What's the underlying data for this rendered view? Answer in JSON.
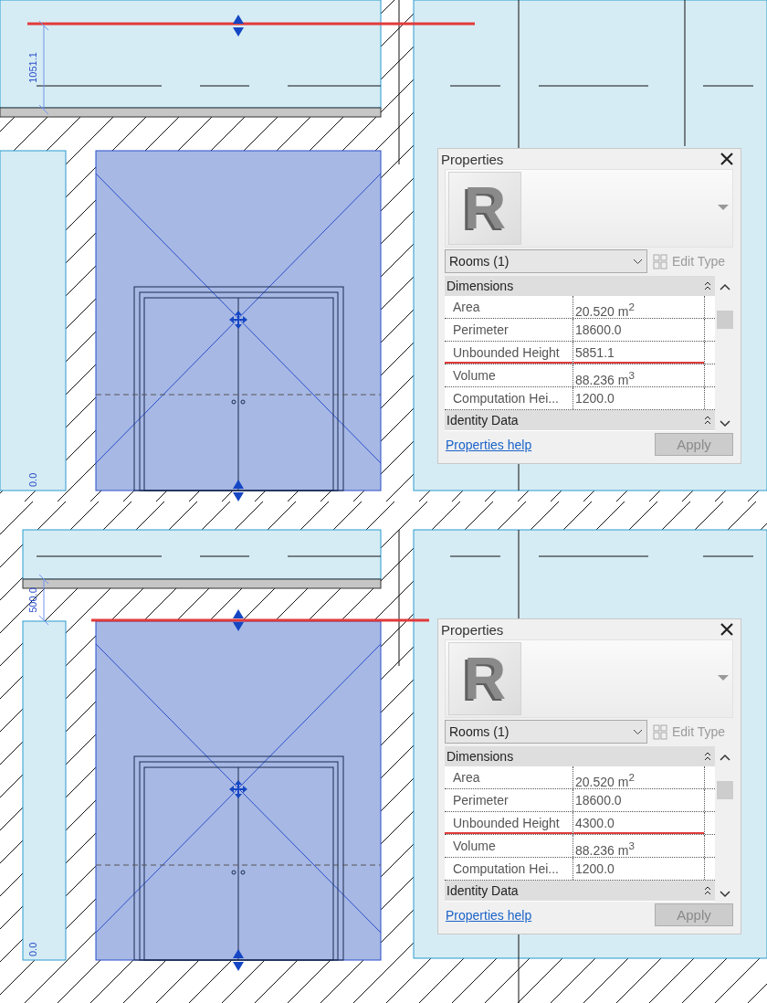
{
  "views": [
    {
      "dimension_labels": [
        "1051.1",
        "0.0"
      ],
      "properties": {
        "title": "Properties",
        "logo": "R",
        "type_selector": "Rooms (1)",
        "edit_type": {
          "label": "Edit Type",
          "disabled": true
        },
        "sections": [
          {
            "title": "Dimensions",
            "rows": [
              {
                "label": "Area",
                "value": "20.520 m$^{2}$",
                "underlined": false
              },
              {
                "label": "Perimeter",
                "value": "18600.0",
                "underlined": false
              },
              {
                "label": "Unbounded Height",
                "value": "5851.1",
                "underlined": true
              },
              {
                "label": "Volume",
                "value": "88.236 m$^{3}$",
                "underlined": false
              },
              {
                "label": "Computation Hei...",
                "value": "1200.0",
                "underlined": false
              }
            ]
          },
          {
            "title": "Identity Data"
          }
        ],
        "help_link": "Properties help",
        "apply": {
          "label": "Apply",
          "disabled": true
        }
      }
    },
    {
      "dimension_labels": [
        "500.0",
        "0.0"
      ],
      "properties": {
        "title": "Properties",
        "logo": "R",
        "type_selector": "Rooms (1)",
        "edit_type": {
          "label": "Edit Type",
          "disabled": true
        },
        "sections": [
          {
            "title": "Dimensions",
            "rows": [
              {
                "label": "Area",
                "value": "20.520 m$^{2}$",
                "underlined": false
              },
              {
                "label": "Perimeter",
                "value": "18600.0",
                "underlined": false
              },
              {
                "label": "Unbounded Height",
                "value": "4300.0",
                "underlined": true
              },
              {
                "label": "Volume",
                "value": "88.236 m$^{3}$",
                "underlined": false
              },
              {
                "label": "Computation Hei...",
                "value": "1200.0",
                "underlined": false
              }
            ]
          },
          {
            "title": "Identity Data"
          }
        ],
        "help_link": "Properties help",
        "apply": {
          "label": "Apply",
          "disabled": true
        }
      }
    }
  ]
}
